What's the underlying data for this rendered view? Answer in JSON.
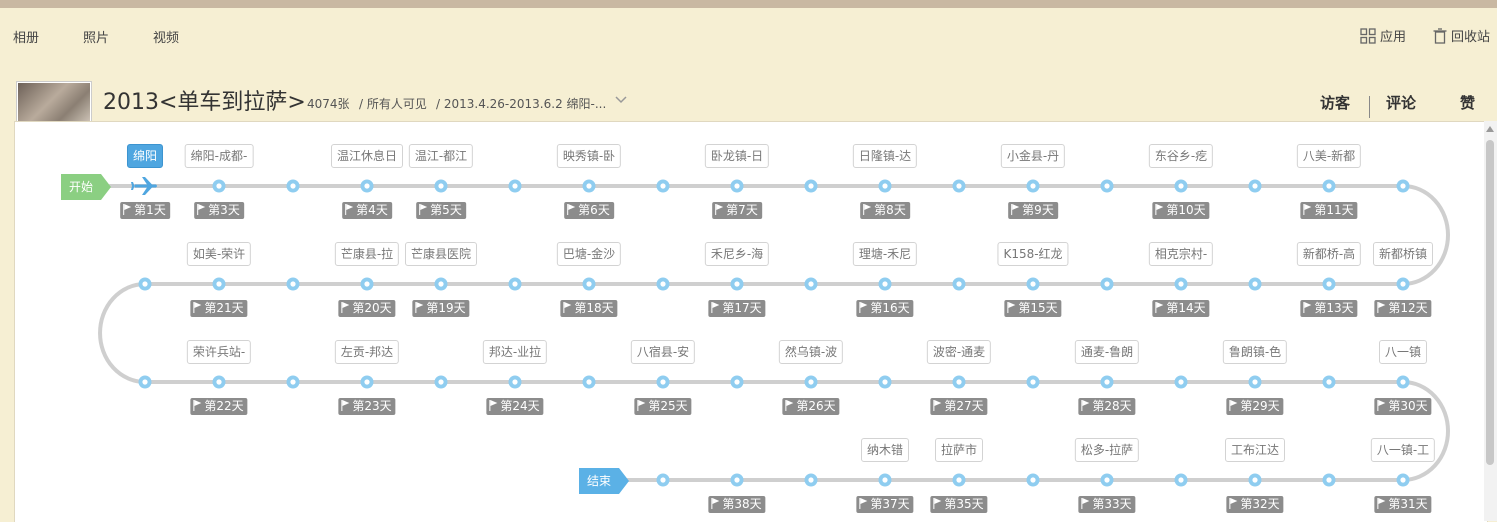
{
  "nav": {
    "albums": "相册",
    "photos": "照片",
    "videos": "视频",
    "apps": "应用",
    "recycle": "回收站"
  },
  "album": {
    "title": "2013<单车到拉萨>",
    "count": "4074张",
    "visibility": "/ 所有人可见",
    "range": "/ 2013.4.26-2013.6.2 绵阳-..."
  },
  "stats": {
    "visitors": "访客",
    "comments": "评论",
    "likes": "赞"
  },
  "route": {
    "start_label": "开始",
    "end_label": "结束",
    "colors": {
      "line": "#cfcfcf",
      "dot": "#8fcdf0",
      "active": "#4fa6e0",
      "start": "#8bcf82",
      "end": "#5bb1e6"
    },
    "rows": [
      {
        "direction": "right",
        "stops": [
          {
            "label": "绵阳",
            "day": "第1天",
            "active": true,
            "icon": "airplane-icon"
          },
          {
            "label": "绵阳-成都-",
            "day": "第3天"
          },
          {},
          {
            "label": "温江休息日",
            "day": "第4天"
          },
          {
            "label": "温江-都江",
            "day": "第5天"
          },
          {},
          {
            "label": "映秀镇-卧",
            "day": "第6天"
          },
          {},
          {
            "label": "卧龙镇-日",
            "day": "第7天"
          },
          {},
          {
            "label": "日隆镇-达",
            "day": "第8天"
          },
          {},
          {
            "label": "小金县-丹",
            "day": "第9天"
          },
          {},
          {
            "label": "东谷乡-疙",
            "day": "第10天"
          },
          {},
          {
            "label": "八美-新都",
            "day": "第11天"
          },
          {}
        ]
      },
      {
        "direction": "left",
        "stops": [
          {},
          {
            "label": "如美-荣许",
            "day": "第21天"
          },
          {},
          {
            "label": "芒康县-拉",
            "day": "第20天"
          },
          {
            "label": "芒康县医院",
            "day": "第19天"
          },
          {},
          {
            "label": "巴塘-金沙",
            "day": "第18天"
          },
          {},
          {
            "label": "禾尼乡-海",
            "day": "第17天"
          },
          {},
          {
            "label": "理塘-禾尼",
            "day": "第16天"
          },
          {},
          {
            "label": "K158-红龙",
            "day": "第15天"
          },
          {},
          {
            "label": "相克宗村-",
            "day": "第14天"
          },
          {},
          {
            "label": "新都桥-高",
            "day": "第13天"
          },
          {
            "label": "新都桥镇",
            "day": "第12天"
          }
        ]
      },
      {
        "direction": "right",
        "stops": [
          {},
          {
            "label": "荣许兵站-",
            "day": "第22天"
          },
          {},
          {
            "label": "左贡-邦达",
            "day": "第23天"
          },
          {},
          {
            "label": "邦达-业拉",
            "day": "第24天"
          },
          {},
          {
            "label": "八宿县-安",
            "day": "第25天"
          },
          {},
          {
            "label": "然乌镇-波",
            "day": "第26天"
          },
          {},
          {
            "label": "波密-通麦",
            "day": "第27天"
          },
          {},
          {
            "label": "通麦-鲁朗",
            "day": "第28天"
          },
          {},
          {
            "label": "鲁朗镇-色",
            "day": "第29天"
          },
          {},
          {
            "label": "八一镇",
            "day": "第30天"
          }
        ]
      },
      {
        "direction": "left",
        "stops": [
          {},
          {},
          {},
          {},
          {},
          {},
          {},
          {},
          {
            "day": "第38天"
          },
          {},
          {
            "label": "纳木错",
            "day": "第37天"
          },
          {
            "label": "拉萨市",
            "day": "第35天"
          },
          {},
          {
            "label": "松多-拉萨",
            "day": "第33天"
          },
          {},
          {
            "label": "工布江达",
            "day": "第32天"
          },
          {},
          {
            "label": "八一镇-工",
            "day": "第31天"
          }
        ]
      }
    ]
  }
}
